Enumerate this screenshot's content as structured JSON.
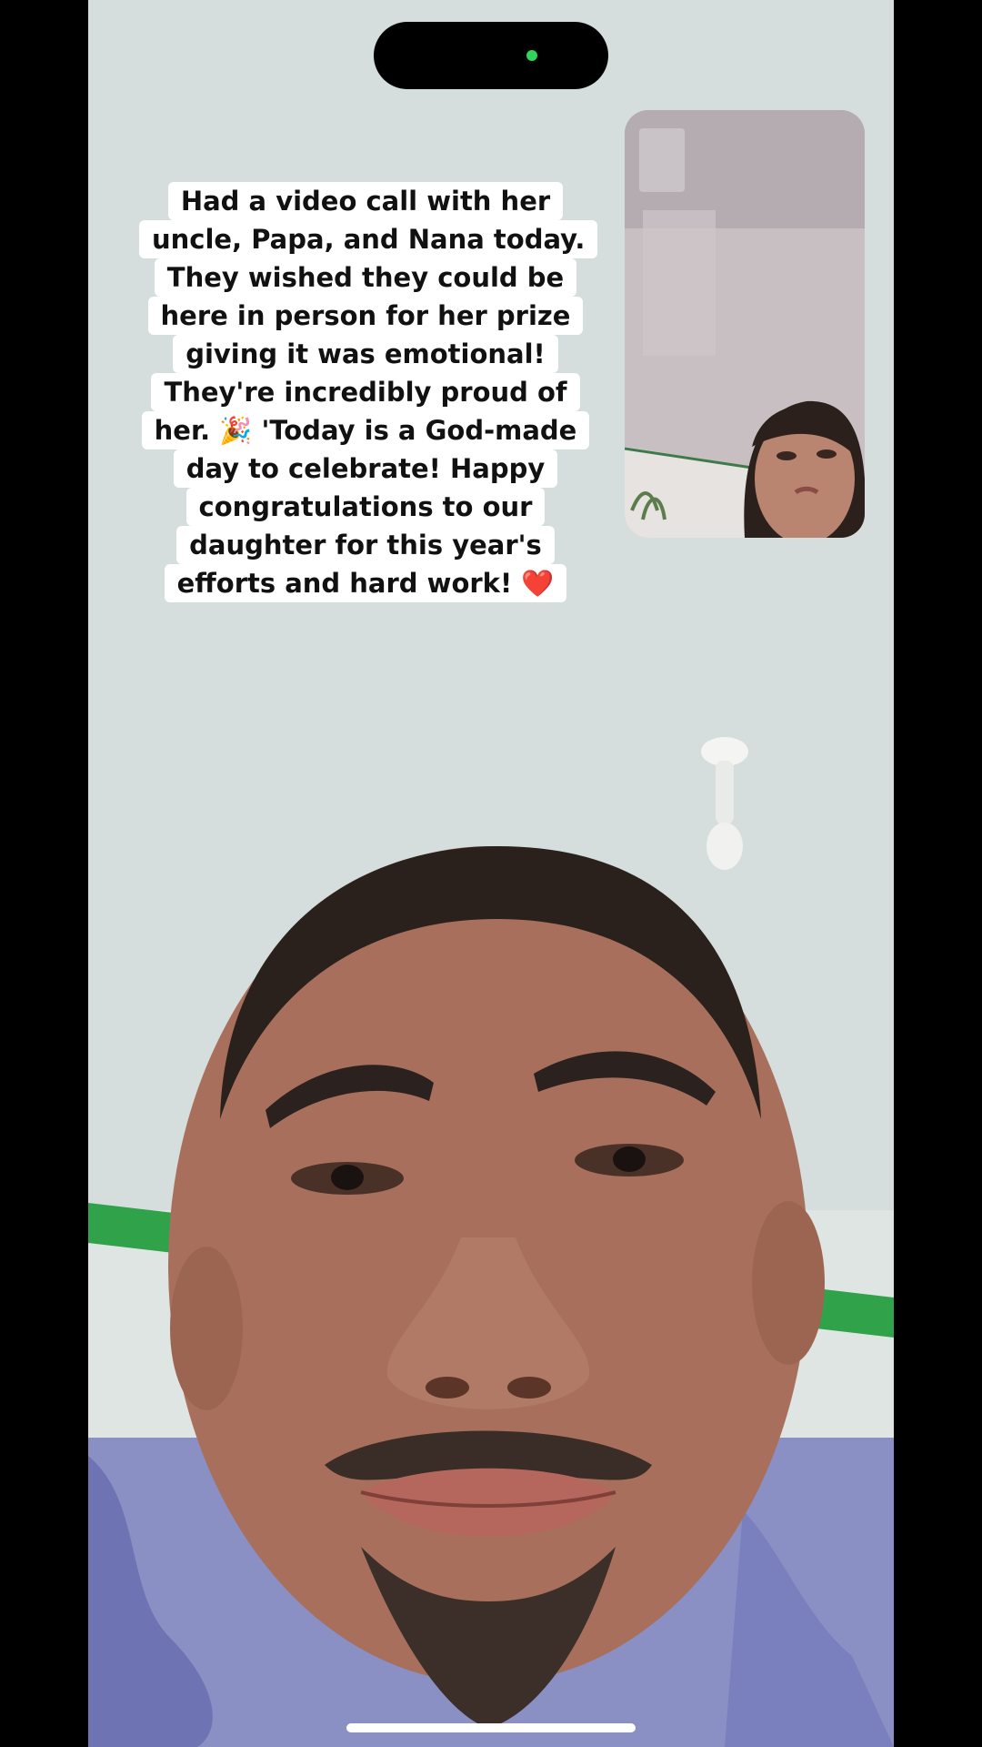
{
  "status": {
    "island_indicator_color": "#32d35a"
  },
  "caption": {
    "lines": [
      "Had a video call with her",
      "uncle, Papa, and Nana today.",
      "They wished they could be",
      "here in person for her prize",
      "giving it was emotional!",
      "They're incredibly proud of",
      "her. 🎉 'Today is a God-made",
      "day to celebrate! Happy",
      "congratulations to our",
      "daughter for this year's",
      "efforts and hard work! ❤️"
    ]
  },
  "call": {
    "main_feed": "remote-caller-video",
    "self_view": "self-view-video"
  },
  "colors": {
    "wall": "#d4dddb",
    "trim_green": "#2fa24a",
    "caption_bg": "#ffffff",
    "caption_text": "#111111"
  }
}
